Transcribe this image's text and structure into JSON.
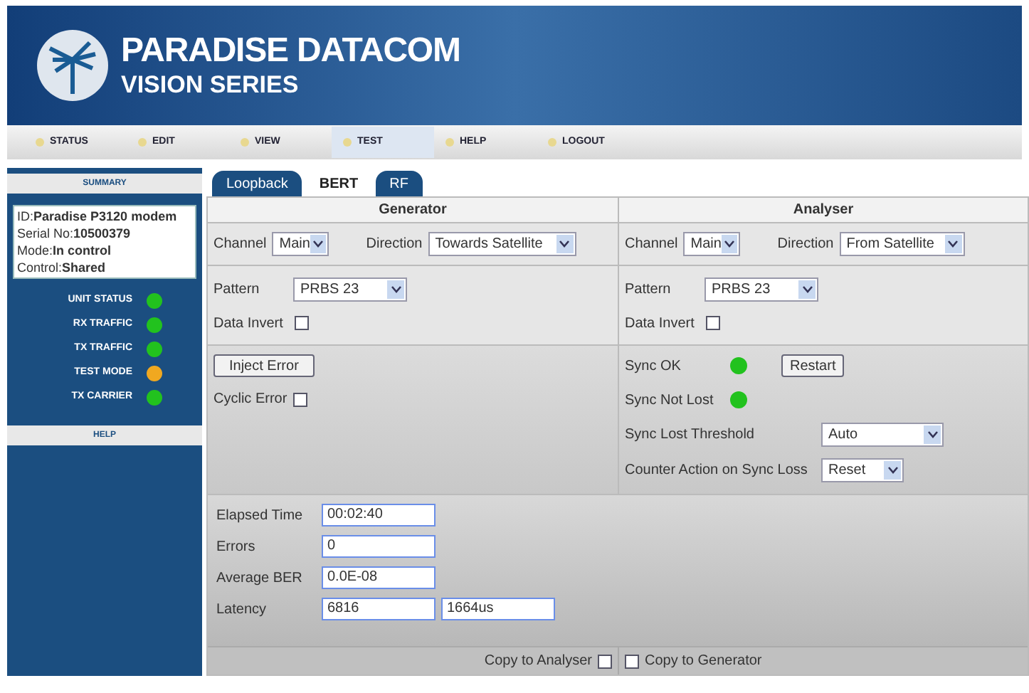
{
  "header": {
    "brand": "PARADISE DATACOM",
    "series": "VISION SERIES"
  },
  "nav": [
    {
      "label": "STATUS",
      "selected": false
    },
    {
      "label": "EDIT",
      "selected": false
    },
    {
      "label": "VIEW",
      "selected": false
    },
    {
      "label": "TEST",
      "selected": true
    },
    {
      "label": "HELP",
      "selected": false
    },
    {
      "label": "LOGOUT",
      "selected": false
    }
  ],
  "sidebar": {
    "summary": "SUMMARY",
    "info": [
      {
        "label": "ID:",
        "value": "Paradise P3120 modem"
      },
      {
        "label": "Serial No:",
        "value": "10500379"
      },
      {
        "label": "Mode:",
        "value": "In control"
      },
      {
        "label": "Control:",
        "value": "Shared"
      }
    ],
    "statuses": [
      {
        "label": "UNIT STATUS",
        "color": "#22c21e"
      },
      {
        "label": "RX TRAFFIC",
        "color": "#22c21e"
      },
      {
        "label": "TX TRAFFIC",
        "color": "#22c21e"
      },
      {
        "label": "TEST MODE",
        "color": "#f0a820"
      },
      {
        "label": "TX CARRIER",
        "color": "#22c21e"
      }
    ],
    "help": "HELP"
  },
  "tabs": [
    {
      "label": "Loopback",
      "selected": false
    },
    {
      "label": "BERT",
      "selected": true
    },
    {
      "label": "RF",
      "selected": false
    }
  ],
  "generator": {
    "title": "Generator",
    "channel_label": "Channel",
    "channel": "Main",
    "direction_label": "Direction",
    "direction": "Towards Satellite",
    "pattern_label": "Pattern",
    "pattern": "PRBS 23",
    "data_invert_label": "Data Invert",
    "data_invert": false,
    "inject_button": "Inject Error",
    "cyclic_label": "Cyclic Error",
    "cyclic": false
  },
  "analyser": {
    "title": "Analyser",
    "channel_label": "Channel",
    "channel": "Main",
    "direction_label": "Direction",
    "direction": "From Satellite",
    "pattern_label": "Pattern",
    "pattern": "PRBS 23",
    "data_invert_label": "Data Invert",
    "data_invert": false,
    "sync": [
      {
        "label": "Sync OK",
        "color": "#22c21e"
      },
      {
        "label": "Sync Not Lost",
        "color": "#22c21e"
      }
    ],
    "restart_button": "Restart",
    "threshold_label": "Sync Lost Threshold",
    "threshold": "Auto",
    "counter_label": "Counter Action on Sync Loss",
    "counter": "Reset"
  },
  "stats": [
    {
      "label": "Elapsed Time",
      "values": [
        "00:02:40"
      ]
    },
    {
      "label": "Errors",
      "values": [
        "0"
      ]
    },
    {
      "label": "Average BER",
      "values": [
        "0.0E-08"
      ]
    },
    {
      "label": "Latency",
      "values": [
        "6816",
        "1664us"
      ]
    }
  ],
  "footer": {
    "copy_to_analyser": "Copy to Analyser",
    "copy_to_analyser_checked": false,
    "copy_to_generator": "Copy to Generator",
    "copy_to_generator_checked": false
  }
}
